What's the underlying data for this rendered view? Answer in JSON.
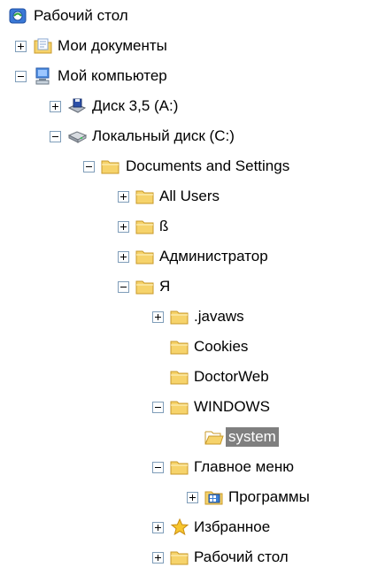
{
  "tree": {
    "items": [
      {
        "label": "Рабочий стол",
        "icon": "desktop-icon",
        "toggle": "none",
        "open": false
      },
      {
        "label": "Мои документы",
        "icon": "my-documents-icon",
        "toggle": "plus",
        "open": false
      },
      {
        "label": "Мой компьютер",
        "icon": "my-computer-icon",
        "toggle": "minus",
        "open": false
      },
      {
        "label": "Диск 3,5 (A:)",
        "icon": "floppy-drive-icon",
        "toggle": "plus",
        "open": false
      },
      {
        "label": "Локальный диск (C:)",
        "icon": "hard-drive-icon",
        "toggle": "minus",
        "open": false
      },
      {
        "label": "Documents and Settings",
        "icon": "folder-icon",
        "toggle": "minus",
        "open": false
      },
      {
        "label": "All Users",
        "icon": "folder-icon",
        "toggle": "plus",
        "open": false
      },
      {
        "label": "ß",
        "icon": "folder-icon",
        "toggle": "plus",
        "open": false
      },
      {
        "label": "Администратор",
        "icon": "folder-icon",
        "toggle": "plus",
        "open": false
      },
      {
        "label": "Я",
        "icon": "folder-icon",
        "toggle": "minus",
        "open": false
      },
      {
        "label": ".javaws",
        "icon": "folder-icon",
        "toggle": "plus",
        "open": false
      },
      {
        "label": "Cookies",
        "icon": "folder-icon",
        "toggle": "none",
        "open": false
      },
      {
        "label": "DoctorWeb",
        "icon": "folder-icon",
        "toggle": "none",
        "open": false
      },
      {
        "label": "WINDOWS",
        "icon": "folder-icon",
        "toggle": "minus",
        "open": false
      },
      {
        "label": "system",
        "icon": "folder-open-icon",
        "toggle": "none",
        "open": true,
        "selected": true
      },
      {
        "label": "Главное меню",
        "icon": "folder-icon",
        "toggle": "minus",
        "open": false
      },
      {
        "label": "Программы",
        "icon": "programs-folder-icon",
        "toggle": "plus",
        "open": false
      },
      {
        "label": "Избранное",
        "icon": "favorites-star-icon",
        "toggle": "plus",
        "open": false
      },
      {
        "label": "Рабочий стол",
        "icon": "folder-icon",
        "toggle": "plus",
        "open": false
      }
    ]
  },
  "colors": {
    "selection_bg": "#7f7f7f",
    "selection_text": "#ffffff",
    "folder_fill": "#f6d36b",
    "folder_stroke": "#c89a2a",
    "toggle_border": "#7f9db9"
  }
}
